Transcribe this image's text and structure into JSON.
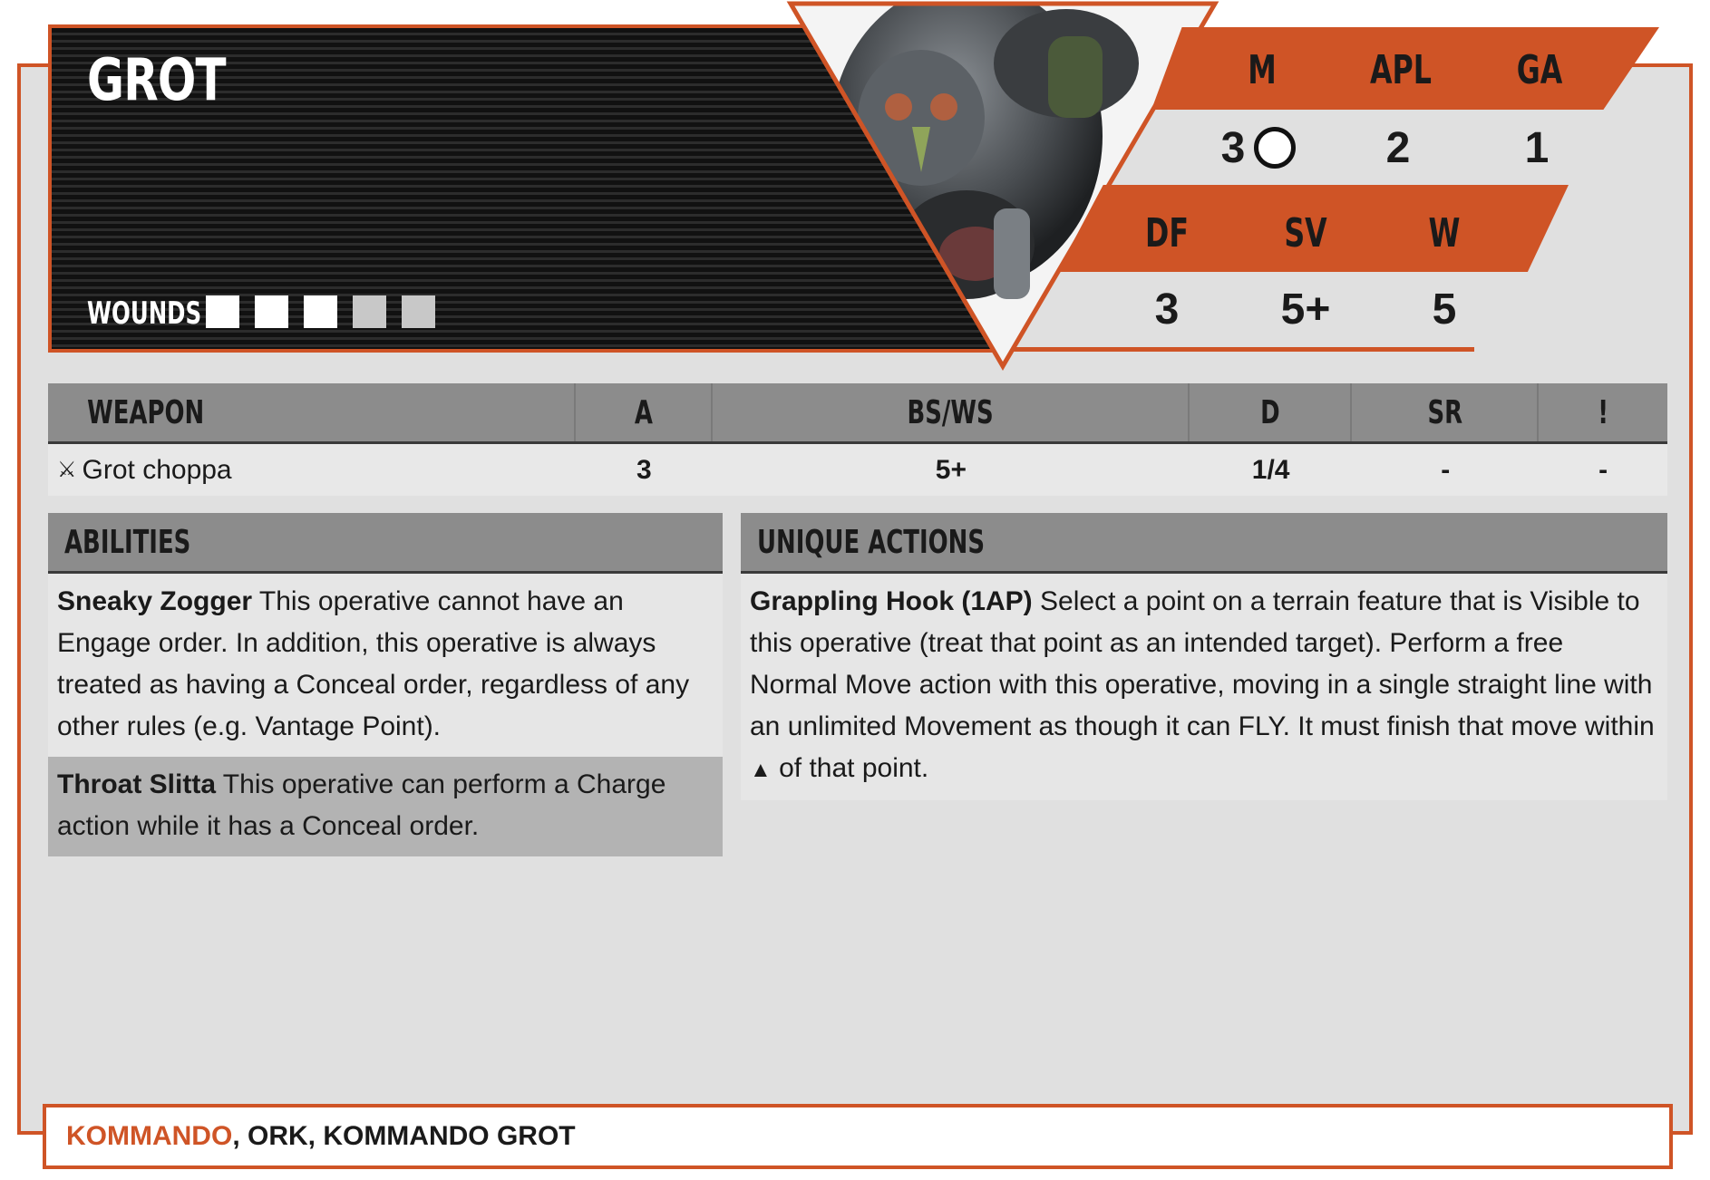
{
  "operative": {
    "name": "Grot",
    "wounds_label": "WOUNDS",
    "wounds": {
      "total": 5,
      "filled": 3
    }
  },
  "stats": {
    "row1": [
      {
        "label": "M",
        "value": "3",
        "icon": "circle-icon"
      },
      {
        "label": "APL",
        "value": "2"
      },
      {
        "label": "GA",
        "value": "1"
      }
    ],
    "row2": [
      {
        "label": "DF",
        "value": "3"
      },
      {
        "label": "SV",
        "value": "5+"
      },
      {
        "label": "W",
        "value": "5"
      }
    ]
  },
  "weapons": {
    "headers": [
      "WEAPON",
      "A",
      "BS/WS",
      "D",
      "SR",
      "!"
    ],
    "rows": [
      {
        "icon": "crossed-swords-icon",
        "glyph": "⚔",
        "name": "Grot choppa",
        "a": "3",
        "bsws": "5+",
        "d": "1/4",
        "sr": "-",
        "crit": "-"
      }
    ]
  },
  "abilities": {
    "title": "ABILITIES",
    "items": [
      {
        "name": "Sneaky Zogger",
        "text": " This operative cannot have an Engage order. In addition, this operative is always treated as having a Conceal order, regardless of any other rules (e.g. Vantage Point)."
      },
      {
        "name": "Throat Slitta",
        "text": " This operative can perform a Charge action while it has a Conceal order."
      }
    ]
  },
  "unique_actions": {
    "title": "UNIQUE ACTIONS",
    "items": [
      {
        "name": "Grappling Hook (1AP)",
        "text": " Select a point on a terrain feature that is Visible to this operative (treat that point as an intended target). Perform a free Normal Move action with this operative, moving in a single straight line with an unlimited Movement as though it can FLY. It must finish that move within ",
        "triangle": "▲",
        "text_end": " of that point."
      }
    ]
  },
  "keywords": {
    "primary": "KOMMANDO",
    "rest": ", ORK, KOMMANDO GROT"
  },
  "colors": {
    "accent": "#cf5426",
    "panel": "#e0e0e0",
    "header_gray": "#8c8c8c"
  }
}
